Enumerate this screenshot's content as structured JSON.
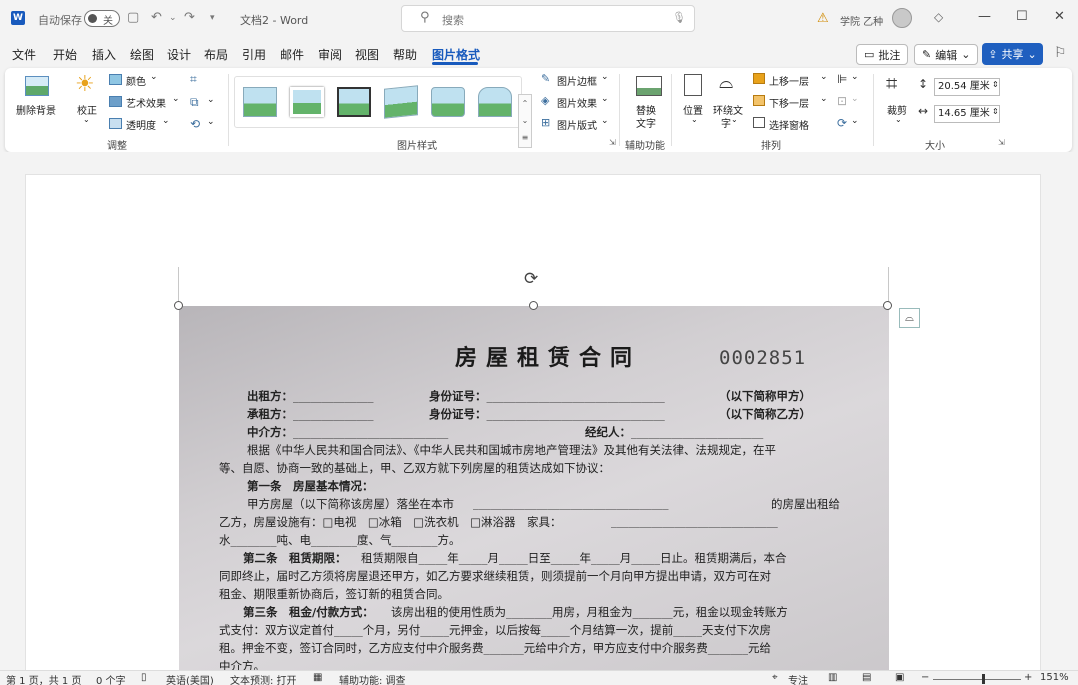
{
  "titlebar": {
    "app_icon": "W",
    "autosave_label": "自动保存",
    "autosave_state": "关",
    "doc_title": "文档2 - Word",
    "search_placeholder": "搜索",
    "account_name": "学院 乙种"
  },
  "tabs": [
    "文件",
    "开始",
    "插入",
    "绘图",
    "设计",
    "布局",
    "引用",
    "邮件",
    "审阅",
    "视图",
    "帮助",
    "图片格式"
  ],
  "active_tab": "图片格式",
  "right_buttons": {
    "comment": "批注",
    "edit": "编辑",
    "share": "共享"
  },
  "ribbon": {
    "remove_bg": "删除背景",
    "corrections": "校正",
    "color": "颜色",
    "artistic": "艺术效果",
    "transparency": "透明度",
    "group_adjust": "调整",
    "group_styles": "图片样式",
    "border": "图片边框",
    "effects": "图片效果",
    "layout": "图片版式",
    "alt_text_1": "替换",
    "alt_text_2": "文字",
    "group_access": "辅助功能",
    "position": "位置",
    "wrap_1": "环绕文",
    "wrap_2": "字",
    "bring_forward": "上移一层",
    "send_backward": "下移一层",
    "selection_pane": "选择窗格",
    "group_arrange": "排列",
    "crop": "裁剪",
    "height": "20.54 厘米",
    "width": "14.65 厘米",
    "group_size": "大小"
  },
  "contract": {
    "title": "房屋租赁合同",
    "serial": "0002851",
    "lessor": "出租方：",
    "lessee": "承租方：",
    "agent": "中介方：",
    "id_no": "身份证号：",
    "abbr_a": "（以下简称甲方）",
    "abbr_b": "（以下简称乙方）",
    "broker": "经纪人：",
    "para1": "根据《中华人民共和国合同法》、《中华人民共和国城市房地产管理法》及其他有关法律、法规规定，在平",
    "para1b": "等、自愿、协商一致的基础上，甲、乙双方就下列房屋的租赁达成如下协议：",
    "art1": "第一条　房屋基本情况：",
    "art1a": "甲方房屋（以下简称该房屋）落坐在本市",
    "art1a_end": "的房屋出租给",
    "art1b": "乙方，房屋设施有：□电视　□冰箱　□洗衣机　□淋浴器　家具：",
    "art1c": "水________吨、电________度、气________方。",
    "art2_head": "第二条　租赁期限：",
    "art2": "租赁期限自_____年_____月_____日至_____年_____月_____日止。租赁期满后，本合",
    "art2b": "同即终止，届时乙方须将房屋退还甲方，如乙方要求继续租赁，则须提前一个月向甲方提出申请，双方可在对",
    "art2c": "租金、期限重新协商后，签订新的租赁合同。",
    "art3_head": "第三条　租金/付款方式：",
    "art3": "该房出租的使用性质为________用房，月租金为_______元，租金以现金转账方",
    "art3b": "式支付：双方议定首付_____个月，另付_____元押金，以后按每_____个月结算一次，提前_____天支付下次房",
    "art3c": "租。押金不变，签订合同时，乙方应支付中介服务费_______元给中介方，甲方应支付中介服务费_______元给",
    "art3d": "中介方。"
  },
  "status": {
    "page": "第 1 页，共 1 页",
    "words": "0 个字",
    "lang": "英语(美国)",
    "predict": "文本预测: 打开",
    "access": "辅助功能: 调查",
    "focus": "专注",
    "zoom": "151%"
  }
}
